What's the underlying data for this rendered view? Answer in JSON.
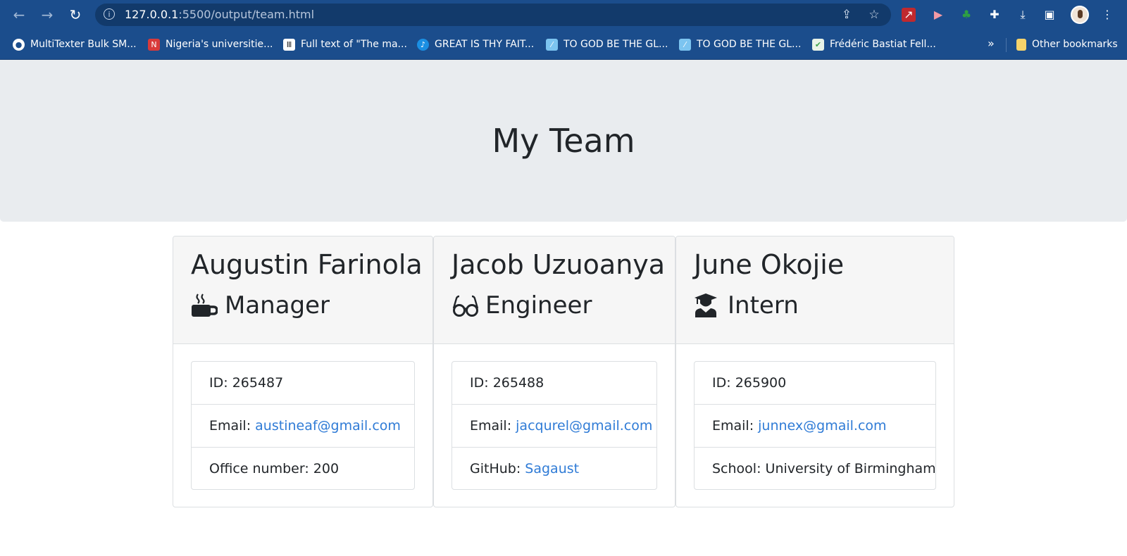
{
  "browser": {
    "url_host": "127.0.0.1",
    "url_path": ":5500/output/team.html",
    "bookmarks": [
      {
        "label": "MultiTexter Bulk SM...",
        "icon": "globe-icon",
        "color": "#1b4d8c"
      },
      {
        "label": "Nigeria's universitie...",
        "icon": "newspaper-icon",
        "color": "#d93a3a"
      },
      {
        "label": "Full text of \"The ma...",
        "icon": "archive-icon",
        "color": "#2b2b2b"
      },
      {
        "label": "GREAT IS THY FAIT...",
        "icon": "music-icon",
        "color": "#1a8fe3"
      },
      {
        "label": "TO GOD BE THE GL...",
        "icon": "document-icon",
        "color": "#7cc4f0"
      },
      {
        "label": "TO GOD BE THE GL...",
        "icon": "document-icon",
        "color": "#7cc4f0"
      },
      {
        "label": "Frédéric Bastiat Fell...",
        "icon": "checkmark-icon",
        "color": "#3fa34d"
      }
    ],
    "overflow": "»",
    "other_bookmarks": "Other bookmarks"
  },
  "page": {
    "title": "My Team"
  },
  "team": [
    {
      "name": "Augustin Farinola",
      "role": "Manager",
      "role_icon": "mug-icon",
      "id_label": "ID: ",
      "id": "265487",
      "email_label": "Email: ",
      "email": "austineaf@gmail.com",
      "extra_label": "Office number: ",
      "extra": "200"
    },
    {
      "name": "Jacob Uzuoanya",
      "role": "Engineer",
      "role_icon": "glasses-icon",
      "id_label": "ID: ",
      "id": "265488",
      "email_label": "Email: ",
      "email": "jacqurel@gmail.com",
      "extra_label": "GitHub: ",
      "extra": "Sagaust"
    },
    {
      "name": "June Okojie",
      "role": "Intern",
      "role_icon": "graduate-icon",
      "id_label": "ID: ",
      "id": "265900",
      "email_label": "Email: ",
      "email": "junnex@gmail.com",
      "extra_label": "School: ",
      "extra": "University of Birmingham"
    }
  ],
  "colors": {
    "chrome": "#1b4d8c",
    "jumbotron": "#e9ecef",
    "link": "#2f7bd6",
    "text": "#212529"
  }
}
